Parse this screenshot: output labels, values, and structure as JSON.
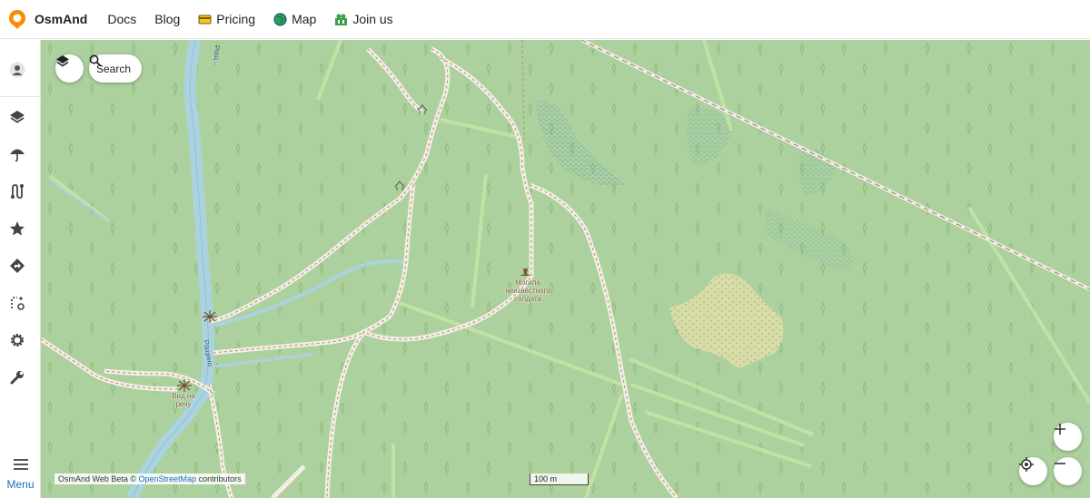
{
  "header": {
    "brand": "OsmAnd",
    "nav": [
      {
        "label": "Docs",
        "icon": ""
      },
      {
        "label": "Blog",
        "icon": ""
      },
      {
        "label": "Pricing",
        "icon": "card-icon"
      },
      {
        "label": "Map",
        "icon": "globe-icon"
      },
      {
        "label": "Join us",
        "icon": "people-icon"
      }
    ]
  },
  "sidebar": {
    "items": [
      {
        "name": "account",
        "icon": "person-icon"
      },
      {
        "name": "layers",
        "icon": "layers-icon"
      },
      {
        "name": "weather",
        "icon": "umbrella-icon"
      },
      {
        "name": "tracks",
        "icon": "route-icon"
      },
      {
        "name": "favorites",
        "icon": "star-icon"
      },
      {
        "name": "navigation",
        "icon": "direction-icon"
      },
      {
        "name": "plan-route",
        "icon": "plan-route-icon"
      },
      {
        "name": "settings",
        "icon": "gear-icon"
      },
      {
        "name": "tools",
        "icon": "wrench-icon"
      }
    ],
    "menu_label": "Menu"
  },
  "map": {
    "search_label": "Search",
    "attribution": {
      "prefix": "OsmAnd Web Beta ©",
      "link": "OpenStreetMap",
      "suffix": "contributors"
    },
    "scale_label": "100 m",
    "pois": [
      {
        "label_lines": [
          "Могила",
          "неизвестного",
          "солдата"
        ]
      },
      {
        "label_lines": [
          "Вид на",
          "речу"
        ]
      }
    ],
    "river_labels": [
      "Рощ...",
      "Ращино"
    ],
    "colors": {
      "forest": "#add19e",
      "water": "#aad3df",
      "meadow": "#d8e3b0",
      "track": "#e4dccd",
      "ride": "#c8e6a8"
    }
  }
}
